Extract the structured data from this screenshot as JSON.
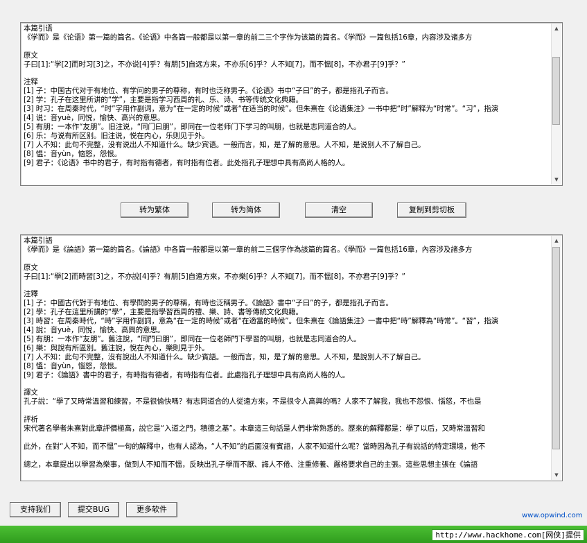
{
  "top_box": {
    "lines": [
      "本篇引语",
      "《学而》是《论语》第一篇的篇名。《论语》中各篇一般都是以第一章的前二三个字作为该篇的篇名。《学而》一篇包括16章，内容涉及诸多方",
      "",
      "原文",
      "子曰[1]:“学[2]而时习[3]之，不亦说[4]乎？有朋[5]自远方来，不亦乐[6]乎？人不知[7]，而不愠[8]，不亦君子[9]乎？”",
      "",
      "注释",
      "[1] 子：中国古代对于有地位、有学问的男子的尊称，有时也泛称男子。《论语》书中“子曰”的子，都是指孔子而言。",
      "[2] 学：孔子在这里所讲的“学”，主要是指学习西周的礼、乐、诗、书等传统文化典籍。",
      "[3] 时习：在周秦时代，“时”字用作副词，意为“在一定的时候”或者“在适当的时候”。但朱熹在《论语集注》一书中把“时”解释为“时常”。“习”，指演",
      "[4] 说：音yuè，同悦，愉快、高兴的意思。",
      "[5] 有朋：一本作“友朋”。旧注说，“同门曰朋”，即同在一位老师门下学习的叫朋，也就是志同道合的人。",
      "[6] 乐：与说有所区别。旧注说，悦在内心，乐则见于外。",
      "[7] 人不知：此句不完整，没有说出人不知道什么。缺少宾语。一般而言，知，是了解的意思。人不知，是说别人不了解自己。",
      "[8] 愠：音yùn，恼怒，怨恨。",
      "[9] 君子：《论语》书中的君子，有时指有德者，有时指有位者。此处指孔子理想中具有高尚人格的人。"
    ]
  },
  "buttons": {
    "to_traditional": "转为繁体",
    "to_simplified": "转为简体",
    "clear": "清空",
    "copy_clipboard": "复制到剪切板"
  },
  "bottom_box": {
    "lines": [
      "本篇引語",
      "《學而》是《論語》第一篇的篇名。《論語》中各篇一般都是以第一章的前二三個字作為該篇的篇名。《學而》一篇包括16章，內容涉及諸多方",
      "",
      "原文",
      "子曰[1]:“學[2]而時習[3]之，不亦說[4]乎？有朋[5]自遠方來，不亦樂[6]乎？人不知[7]，而不慍[8]，不亦君子[9]乎？”",
      "",
      "注釋",
      "[1] 子：中國古代對于有地位、有學問的男子的尊稱，有時也泛稱男子。《論語》書中“子曰”的子，都是指孔子而言。",
      "[2] 學：孔子在這里所講的“學”，主要是指學習西周的禮、樂、詩、書等傳統文化典籍。",
      "[3] 時習：在周秦時代，“時”字用作副詞，意為“在一定的時候”或者“在適當的時候”。但朱熹在《論語集注》一書中把“時”解釋為“時常”。“習”，指演",
      "[4] 說：音yuè，同悅，愉快、高興的意思。",
      "[5] 有朋：一本作“友朋”。舊注說，“同門曰朋”，即同在一位老師門下學習的叫朋，也就是志同道合的人。",
      "[6] 樂：與說有所區別。舊注說，悅在內心，樂則見于外。",
      "[7] 人不知：此句不完整，沒有說出人不知道什么。缺少賓語。一般而言，知，是了解的意思。人不知，是說別人不了解自己。",
      "[8] 慍：音yùn，惱怒，怨恨。",
      "[9] 君子：《論語》書中的君子，有時指有德者，有時指有位者。此處指孔子理想中具有高尚人格的人。",
      "",
      "譯文",
      "孔子說：“學了又時常溫習和練習，不是很愉快嗎？有志同道合的人從遠方來，不是很令人高興的嗎？人家不了解我，我也不怨恨、惱怒，不也是",
      "",
      "評析",
      "宋代著名學者朱熹對此章評價極高，說它是“入道之門，積德之基”。本章這三句話是人們非常熟悉的。歷來的解釋都是：學了以后，又時常溫習和",
      "",
      "此外，在對“人不知，而不慍”一句的解釋中，也有人認為，“人不知”的后面沒有賓語，人家不知道什么呢？當時因為孔子有說話的特定環境，他不",
      "",
      "總之，本章提出以學習為樂事，做到人不知而不慍，反映出孔子學而不厭、誨人不倦、注重修養、嚴格要求自己的主張。這些思想主張在《論語"
    ]
  },
  "bottom_buttons": {
    "support": "支持我们",
    "submit_bug": "提交BUG",
    "more_software": "更多软件"
  },
  "footer": {
    "site_link": "www.opwind.com",
    "banner": "http://www.hackhome.com[网侠]提供"
  }
}
